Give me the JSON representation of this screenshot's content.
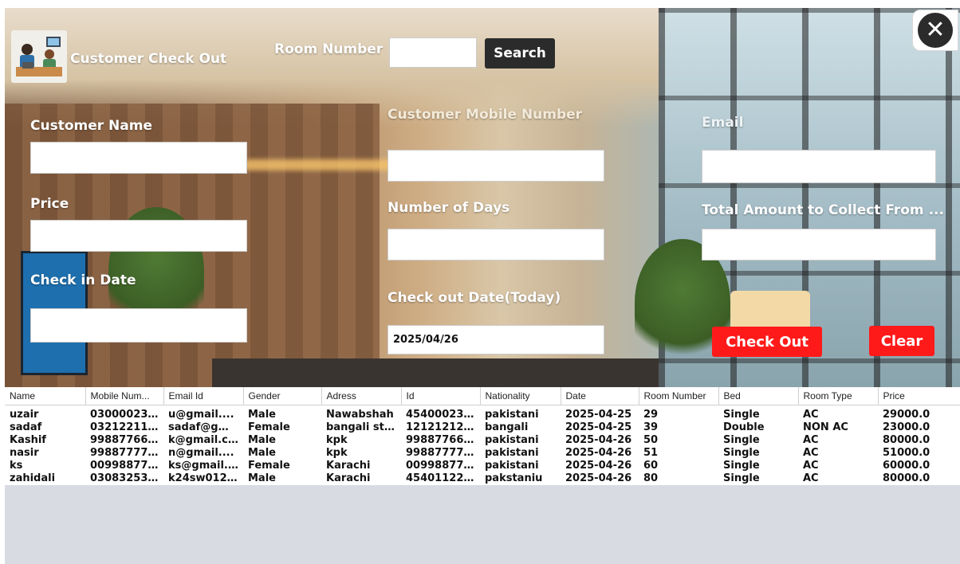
{
  "window": {
    "title": "Customer Check Out",
    "close_glyph": "✕"
  },
  "search": {
    "room_number_label": "Room Number",
    "room_number_value": "",
    "button_label": "Search"
  },
  "form": {
    "customer_name_label": "Customer Name",
    "customer_name_value": "",
    "mobile_label": "Customer Mobile Number",
    "mobile_value": "",
    "email_label": "Email",
    "email_value": "",
    "price_label": "Price",
    "price_value": "",
    "days_label": "Number of Days",
    "days_value": "",
    "total_label": "Total Amount to Collect From ...",
    "total_value": "",
    "checkin_label": "Check in Date",
    "checkin_value": "",
    "checkout_label": "Check out Date(Today)",
    "checkout_value": "2025/04/26"
  },
  "actions": {
    "checkout_label": "Check Out",
    "clear_label": "Clear",
    "accent_color": "#ff1a1a"
  },
  "table": {
    "columns": [
      "Name",
      "Mobile Num...",
      "Email Id",
      "Gender",
      "Adress",
      "Id",
      "Nationality",
      "Date",
      "Room Number",
      "Bed",
      "Room Type",
      "Price"
    ],
    "rows": [
      [
        "uzair",
        "03000023...",
        "u@gmail....",
        "Male",
        "Nawabshah",
        "45400023...",
        "pakistani",
        "2025-04-25",
        "29",
        "Single",
        "AC",
        "29000.0"
      ],
      [
        "sadaf",
        "03212211...",
        "sadaf@gm...",
        "Female",
        "bangali str...",
        "12121212...",
        "bangali",
        "2025-04-25",
        "39",
        "Double",
        "NON AC",
        "23000.0"
      ],
      [
        "Kashif",
        "99887766...",
        "k@gmail.c...",
        "Male",
        "kpk",
        "99887766...",
        "pakistani",
        "2025-04-26",
        "50",
        "Single",
        "AC",
        "80000.0"
      ],
      [
        "nasir",
        "99887777...",
        "n@gmail....",
        "Male",
        "kpk",
        "99887777...",
        "pakistani",
        "2025-04-26",
        "51",
        "Single",
        "AC",
        "51000.0"
      ],
      [
        "ks",
        "00998877...",
        "ks@gmail....",
        "Female",
        "Karachi",
        "00998877...",
        "pakistani",
        "2025-04-26",
        "60",
        "Single",
        "AC",
        "60000.0"
      ],
      [
        "zahidali",
        "03083253...",
        "k24sw012...",
        "Male",
        "Karachi",
        "45401122...",
        "pakstaniu",
        "2025-04-26",
        "80",
        "Single",
        "AC",
        "80000.0"
      ]
    ]
  }
}
